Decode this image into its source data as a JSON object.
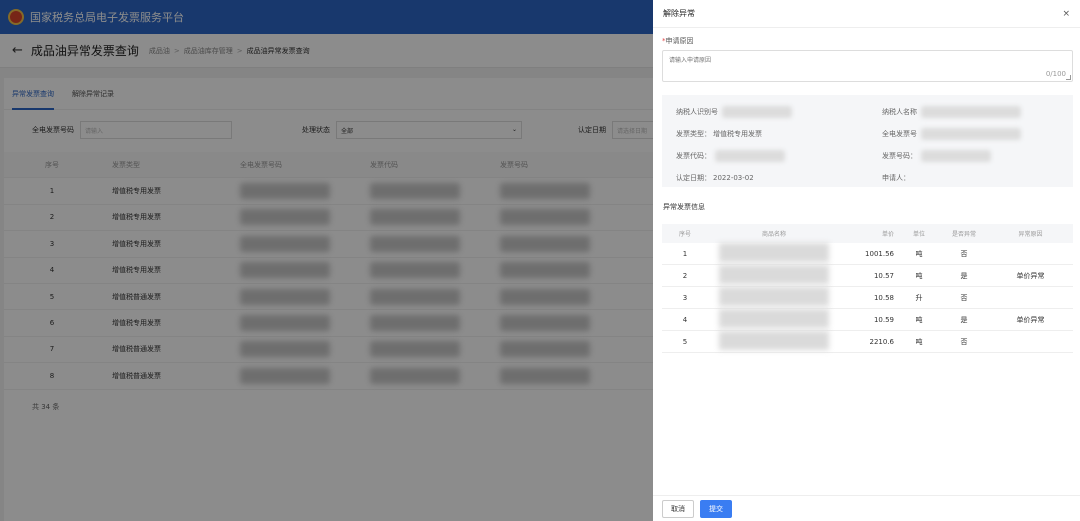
{
  "background": {
    "app_title": "国家税务总局电子发票服务平台",
    "page_title": "成品油异常发票查询",
    "breadcrumb": [
      "成品油",
      "成品油库存管理",
      "成品油异常发票查询"
    ],
    "tabs": [
      "异常发票查询",
      "解除异常记录"
    ],
    "filters": {
      "invoice_no_label": "全电发票号码",
      "invoice_no_placeholder": "请输入",
      "status_label": "处理状态",
      "status_value": "全部",
      "date_label": "认定日期",
      "date_placeholder": "请选择日期"
    },
    "table_headers": [
      "序号",
      "发票类型",
      "全电发票号码",
      "发票代码",
      "发票号码"
    ],
    "rows": [
      {
        "no": "1",
        "type": "增值税专用发票"
      },
      {
        "no": "2",
        "type": "增值税专用发票"
      },
      {
        "no": "3",
        "type": "增值税专用发票"
      },
      {
        "no": "4",
        "type": "增值税专用发票"
      },
      {
        "no": "5",
        "type": "增值税普通发票"
      },
      {
        "no": "6",
        "type": "增值税专用发票"
      },
      {
        "no": "7",
        "type": "增值税普通发票"
      },
      {
        "no": "8",
        "type": "增值税普通发票"
      }
    ],
    "total": "共 34 条"
  },
  "drawer": {
    "title": "解除异常",
    "reason_label": "申请原因",
    "reason_placeholder": "请输入申请原因",
    "reason_count": "0/100",
    "info": {
      "taxpayer_id_label": "纳税人识别号",
      "taxpayer_name_label": "纳税人名称",
      "invoice_type_label": "发票类型：",
      "invoice_type_value": "增值税专用发票",
      "full_invoice_no_label": "全电发票号",
      "invoice_code_label": "发票代码：",
      "invoice_number_label": "发票号码：",
      "date_label": "认定日期：",
      "date_value": "2022-03-02",
      "applicant_label": "申请人："
    },
    "section_title": "异常发票信息",
    "table_headers": [
      "序号",
      "商品名称",
      "单价",
      "单位",
      "是否异常",
      "异常原因"
    ],
    "rows": [
      {
        "no": "1",
        "price": "1001.56",
        "unit": "吨",
        "abnormal": "否",
        "reason": ""
      },
      {
        "no": "2",
        "price": "10.57",
        "unit": "吨",
        "abnormal": "是",
        "reason": "单价异常"
      },
      {
        "no": "3",
        "price": "10.58",
        "unit": "升",
        "abnormal": "否",
        "reason": ""
      },
      {
        "no": "4",
        "price": "10.59",
        "unit": "吨",
        "abnormal": "是",
        "reason": "单价异常"
      },
      {
        "no": "5",
        "price": "2210.6",
        "unit": "吨",
        "abnormal": "否",
        "reason": ""
      }
    ],
    "cancel_label": "取消",
    "submit_label": "提交",
    "close_glyph": "×"
  },
  "colors": {
    "brand_blue": "#2d67c6",
    "primary_button": "#3a7df2",
    "required_star": "#e54545"
  }
}
